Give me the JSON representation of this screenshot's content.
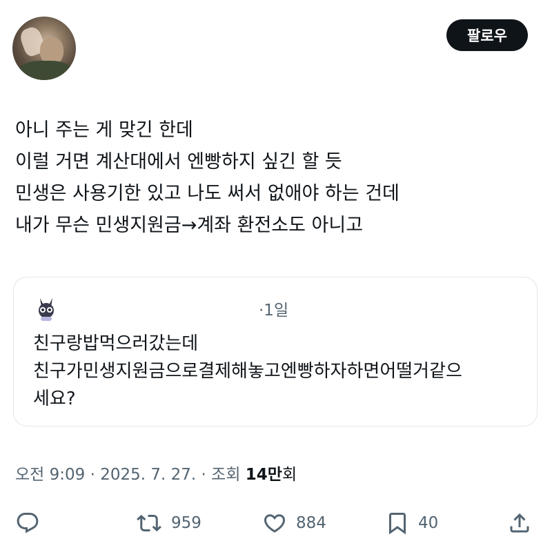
{
  "header": {
    "follow_label": "팔로우"
  },
  "tweet": {
    "lines": [
      "아니 주는 게 맞긴 한데",
      "이럴 거면 계산대에서 엔빵하지 싶긴 할 듯",
      "민생은 사용기한 있고 나도 써서 없애야 하는 건데",
      "내가 무슨 민생지원금→계좌 환전소도 아니고"
    ]
  },
  "quote": {
    "time": "·1일",
    "lines": [
      "친구랑밥먹으러갔는데",
      "친구가민생지원금으로결제해놓고엔빵하자하면어떨거같으",
      "세요?"
    ]
  },
  "meta": {
    "time": "오전 9:09",
    "date": "2025. 7. 27.",
    "views_prefix": "조회",
    "views_num": "14만",
    "views_unit": "회"
  },
  "actions": {
    "reply_icon": "reply-icon",
    "retweet_count": "959",
    "like_count": "884",
    "bookmark_count": "40",
    "share_icon": "share-icon"
  },
  "colors": {
    "text": "#0f1419",
    "secondary": "#536471",
    "border": "#e1e6ea"
  }
}
